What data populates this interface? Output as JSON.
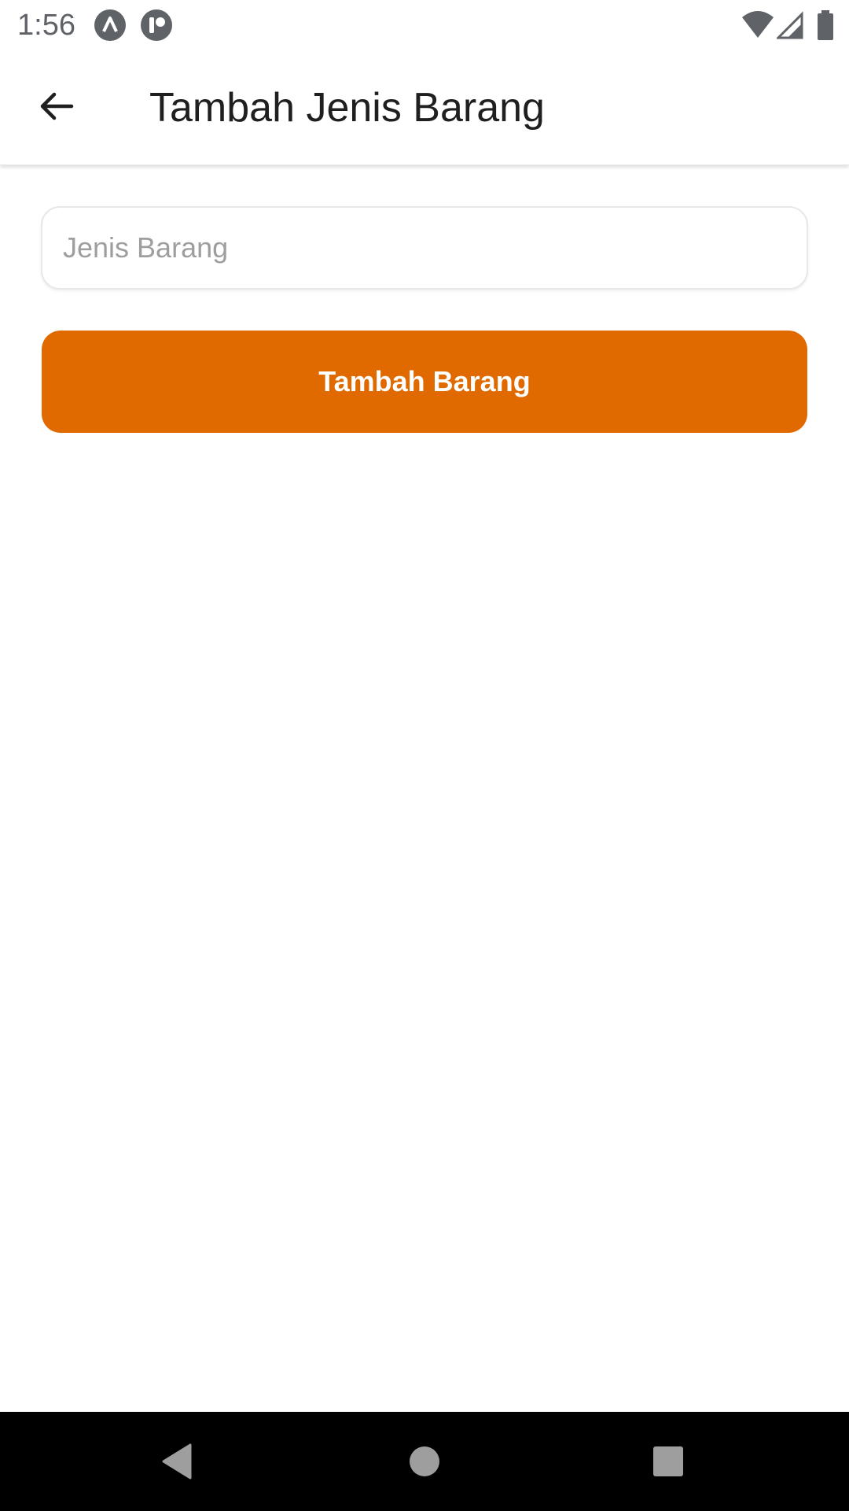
{
  "status_bar": {
    "time": "1:56",
    "icons": [
      "app-a-icon",
      "app-p-icon",
      "wifi-icon",
      "cellular-signal-icon",
      "battery-icon"
    ]
  },
  "app_bar": {
    "title": "Tambah Jenis Barang",
    "back_icon": "arrow-back-icon"
  },
  "form": {
    "input_placeholder": "Jenis Barang",
    "input_value": "",
    "submit_label": "Tambah Barang"
  },
  "nav_bar": {
    "icons": [
      "back-triangle-icon",
      "home-circle-icon",
      "recents-square-icon"
    ]
  },
  "colors": {
    "accent": "#e06a00",
    "title_text": "#1f1f1f",
    "placeholder": "#9e9e9e",
    "nav_background": "#000000"
  }
}
